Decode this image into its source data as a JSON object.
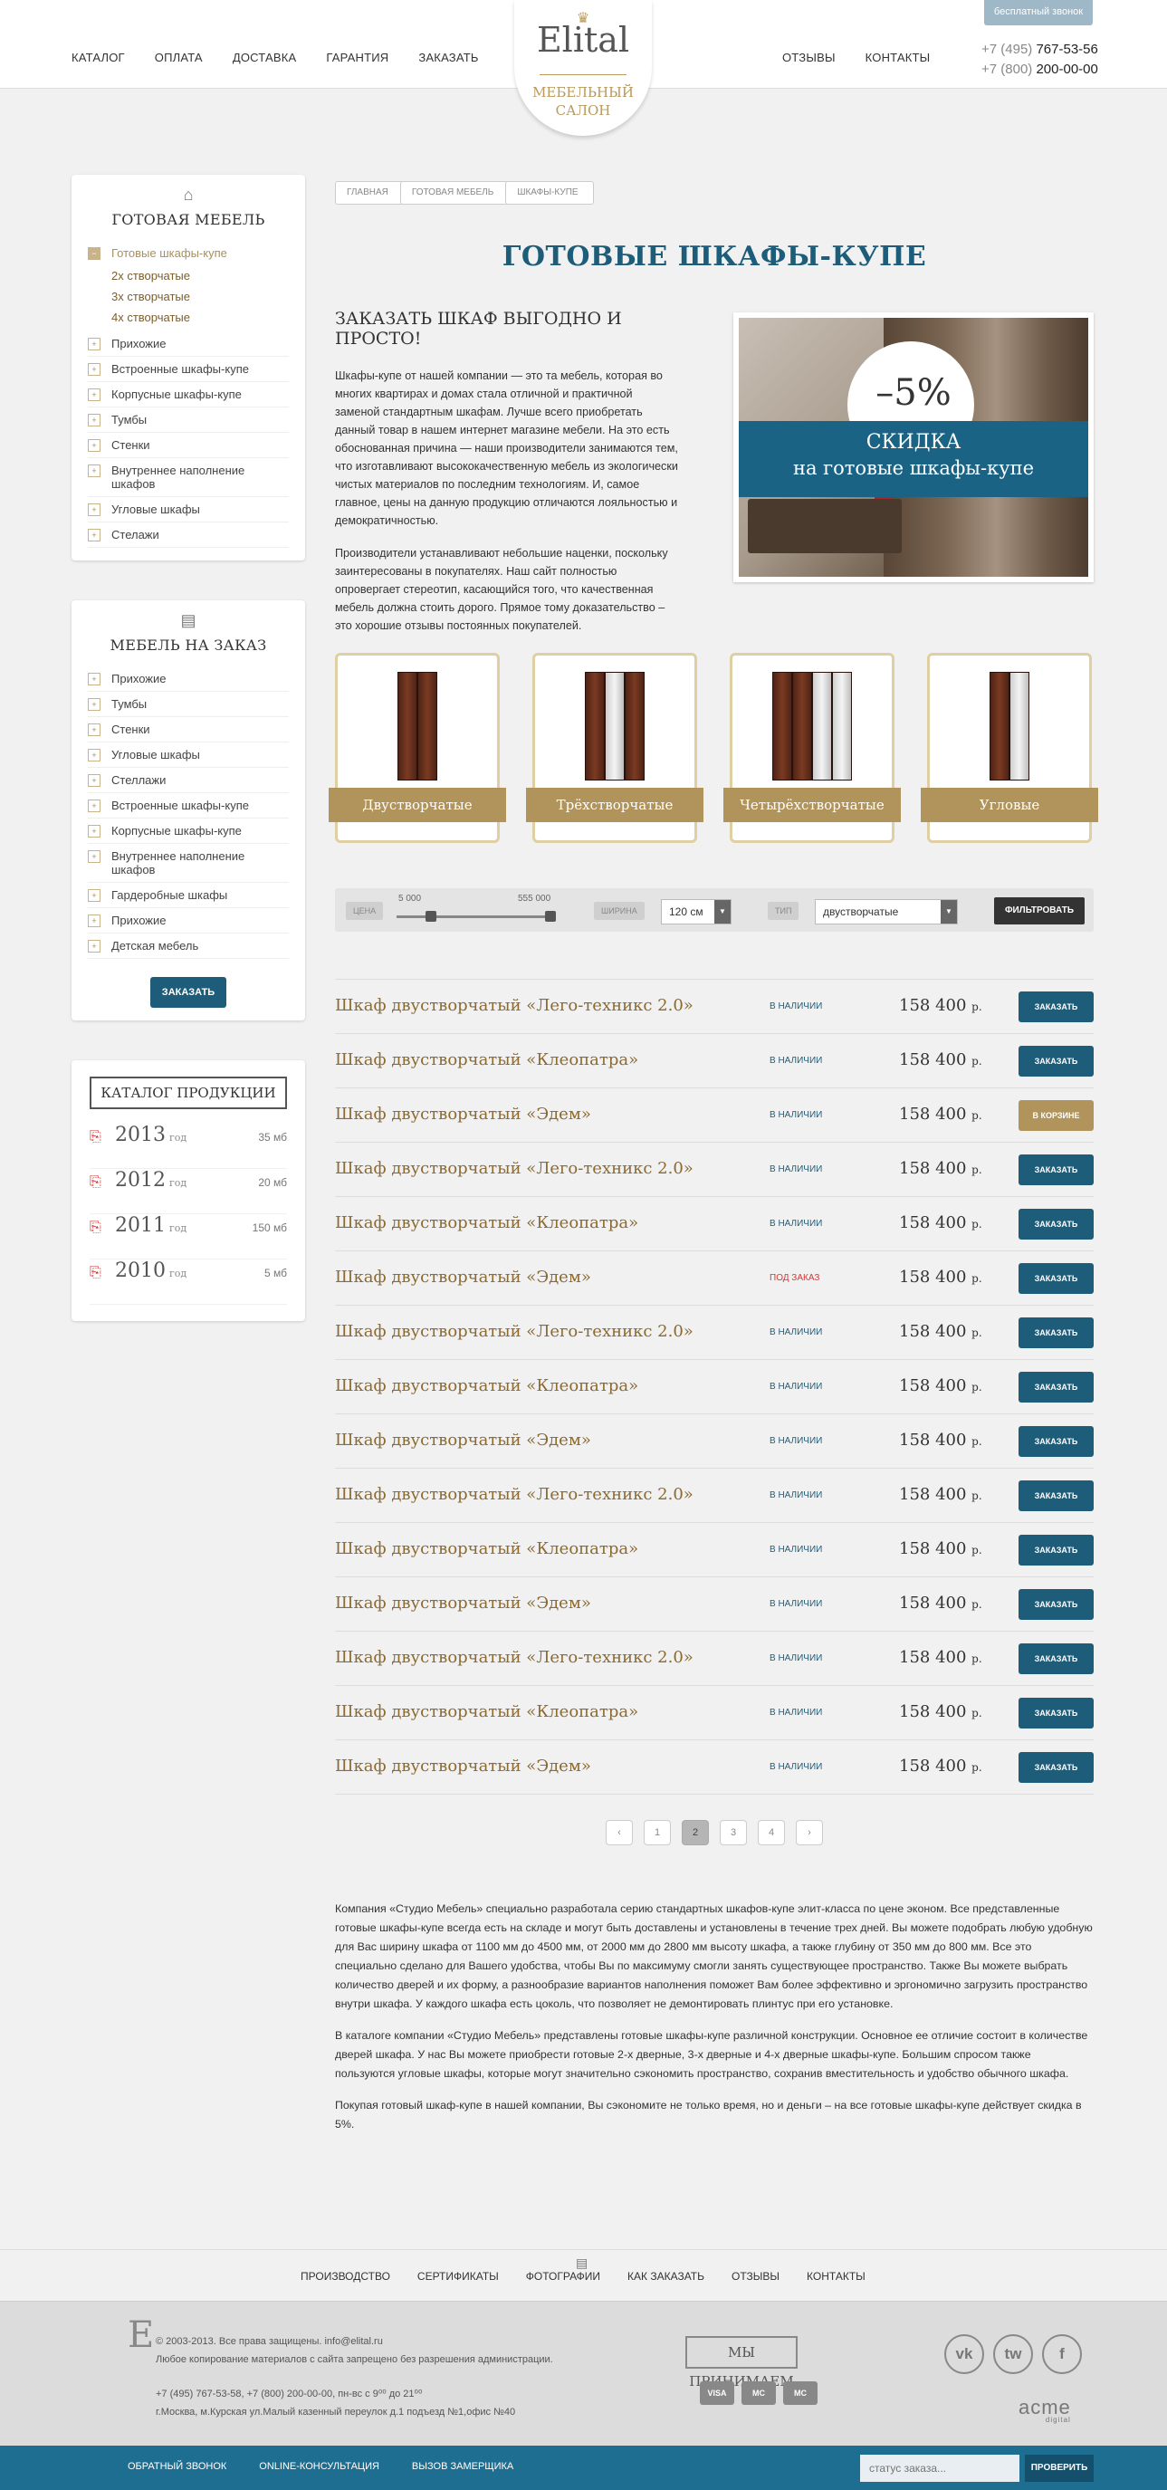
{
  "header": {
    "nav_left": [
      "Каталог",
      "Оплата",
      "Доставка",
      "Гарантия",
      "Заказать"
    ],
    "nav_right": [
      "Отзывы",
      "Контакты"
    ],
    "logo": {
      "name": "Elital",
      "sub1": "Мебельный",
      "sub2": "салон"
    },
    "callback_label": "бесплатный звонок",
    "phones": [
      {
        "code": "+7 (495)",
        "num": "767-53-56"
      },
      {
        "code": "+7 (800)",
        "num": "200-00-00"
      }
    ]
  },
  "sidebar": {
    "ready": {
      "title": "Готовая мебель",
      "active": "Готовые шкафы-купе",
      "subitems": [
        "2х створчатые",
        "3х створчатые",
        "4х створчатые"
      ],
      "items": [
        "Прихожие",
        "Встроенные шкафы-купе",
        "Корпусные шкафы-купе",
        "Тумбы",
        "Стенки",
        "Внутреннее наполнение шкафов",
        "Угловые шкафы",
        "Стелажи"
      ]
    },
    "custom": {
      "title": "Мебель на заказ",
      "items": [
        "Прихожие",
        "Тумбы",
        "Стенки",
        "Угловые шкафы",
        "Стеллажи",
        "Встроенные шкафы-купе",
        "Корпусные шкафы-купе",
        "Внутреннее наполнение шкафов",
        "Гардеробные шкафы",
        "Прихожие",
        "Детская мебель"
      ],
      "order_label": "Заказать"
    },
    "catalog": {
      "title": "Каталог продукции",
      "rows": [
        {
          "year": "2013",
          "unit": "год",
          "size": "35 мб"
        },
        {
          "year": "2012",
          "unit": "год",
          "size": "20 мб"
        },
        {
          "year": "2011",
          "unit": "год",
          "size": "150 мб"
        },
        {
          "year": "2010",
          "unit": "год",
          "size": "5 мб"
        }
      ]
    }
  },
  "main": {
    "breadcrumb": [
      "Главная",
      "Готовая мебель",
      "Шкафы-купе"
    ],
    "title": "Готовые шкафы-купе",
    "promo_heading": "Заказать шкаф выгодно и просто!",
    "promo_p1": "Шкафы-купе от нашей компании — это та мебель, которая во многих квартирах и домах стала отличной и практичной заменой стандартным шкафам. Лучше всего приобретать данный товар в нашем интернет магазине мебели. На это есть обоснованная причина — наши производители занимаются тем, что изготавливают высококачественную мебель из экологически чистых материалов по последним технологиям. И, самое главное, цены на данную продукцию отличаются лояльностью и демократичностью.",
    "promo_p2": "Производители устанавливают небольшие наценки, поскольку заинтересованы в покупателях. Наш сайт полностью опровергает стереотип, касающийся того, что качественная мебель должна стоить дорого. Прямое тому доказательство – это хорошие отзывы постоянных покупателей.",
    "banner": {
      "percent": "–5%",
      "line1": "Скидка",
      "line2": "на готовые шкафы-купе"
    },
    "categories": [
      {
        "label": "Двустворчатые",
        "panels": [
          "wood",
          "wood"
        ]
      },
      {
        "label": "Трёхстворчатые",
        "panels": [
          "wood",
          "mirror",
          "wood"
        ]
      },
      {
        "label": "Четырёхстворчатые",
        "panels": [
          "wood",
          "wood",
          "mirror",
          "mirror"
        ]
      },
      {
        "label": "Угловые",
        "panels": [
          "wood",
          "mirror"
        ]
      }
    ],
    "filter": {
      "price_tag": "Цена",
      "price_min": "5 000",
      "price_max": "555 000",
      "width_tag": "Ширина",
      "width_value": "120 см",
      "type_tag": "Тип",
      "type_value": "двустворчатые",
      "button": "Фильтровать"
    },
    "products": [
      {
        "name": "Шкаф двустворчатый «Лего-техникс 2.0»",
        "status": "в наличии",
        "price": "158 400",
        "btn": "Заказать"
      },
      {
        "name": "Шкаф двустворчатый «Клеопатра»",
        "status": "в наличии",
        "price": "158 400",
        "btn": "Заказать"
      },
      {
        "name": "Шкаф двустворчатый «Эдем»",
        "status": "в наличии",
        "price": "158 400",
        "btn": "В корзине"
      },
      {
        "name": "Шкаф двустворчатый «Лего-техникс 2.0»",
        "status": "в наличии",
        "price": "158 400",
        "btn": "Заказать"
      },
      {
        "name": "Шкаф двустворчатый «Клеопатра»",
        "status": "в наличии",
        "price": "158 400",
        "btn": "Заказать"
      },
      {
        "name": "Шкаф двустворчатый «Эдем»",
        "status": "под заказ",
        "price": "158 400",
        "btn": "Заказать"
      },
      {
        "name": "Шкаф двустворчатый «Лего-техникс 2.0»",
        "status": "в наличии",
        "price": "158 400",
        "btn": "Заказать"
      },
      {
        "name": "Шкаф двустворчатый «Клеопатра»",
        "status": "в наличии",
        "price": "158 400",
        "btn": "Заказать"
      },
      {
        "name": "Шкаф двустворчатый «Эдем»",
        "status": "в наличии",
        "price": "158 400",
        "btn": "Заказать"
      },
      {
        "name": "Шкаф двустворчатый «Лего-техникс 2.0»",
        "status": "в наличии",
        "price": "158 400",
        "btn": "Заказать"
      },
      {
        "name": "Шкаф двустворчатый «Клеопатра»",
        "status": "в наличии",
        "price": "158 400",
        "btn": "Заказать"
      },
      {
        "name": "Шкаф двустворчатый «Эдем»",
        "status": "в наличии",
        "price": "158 400",
        "btn": "Заказать"
      },
      {
        "name": "Шкаф двустворчатый «Лего-техникс 2.0»",
        "status": "в наличии",
        "price": "158 400",
        "btn": "Заказать"
      },
      {
        "name": "Шкаф двустворчатый «Клеопатра»",
        "status": "в наличии",
        "price": "158 400",
        "btn": "Заказать"
      },
      {
        "name": "Шкаф двустворчатый «Эдем»",
        "status": "в наличии",
        "price": "158 400",
        "btn": "Заказать"
      }
    ],
    "price_unit": "р.",
    "pager": [
      "‹",
      "1",
      "2",
      "3",
      "4",
      "›"
    ],
    "pager_current": "2",
    "seo": [
      "Компания «Студио Мебель» специально разработала серию стандартных шкафов-купе элит-класса по цене эконом. Все представленные готовые шкафы-купе всегда есть на складе и могут быть доставлены и установлены в течение трех дней. Вы можете подобрать любую удобную для Вас ширину шкафа от 1100 мм до 4500 мм, от 2000 мм до 2800 мм высоту шкафа, а также глубину от 350 мм до 800 мм. Все это специально сделано для Вашего удобства, чтобы Вы по максимуму смогли занять существующее пространство. Также Вы можете выбрать количество дверей и их форму, а разнообразие вариантов наполнения поможет Вам более эффективно и эргономично загрузить пространство внутри шкафа. У каждого шкафа есть цоколь, что позволяет не демонтировать плинтус при его установке.",
      "В каталоге компании «Студио Мебель» представлены готовые шкафы-купе различной конструкции. Основное ее отличие состоит в количестве дверей шкафа. У нас Вы можете приобрести готовые 2-х дверные, 3-х дверные и 4-х дверные шкафы-купе. Большим спросом также пользуются угловые шкафы, которые могут значительно сэкономить пространство, сохранив вместительность и удобство обычного шкафа.",
      "Покупая готовый шкаф-купе в нашей компании, Вы сэкономите не только время, но и деньги – на все готовые шкафы-купе действует скидка в 5%."
    ]
  },
  "footer": {
    "nav": [
      "Производство",
      "Сертификаты",
      "Фотографии",
      "Как заказать",
      "Отзывы",
      "Контакты"
    ],
    "logo_letter": "E",
    "copyright": "© 2003-2013. Все права защищены. info@elital.ru",
    "copy_note": "Любое копирование материалов с сайта запрещено без разрешения администрации.",
    "contacts": "+7 (495) 767-53-58, +7 (800) 200-00-00, пн-вс с 9⁰⁰ до 21⁰⁰",
    "address": "г.Москва, м.Курская ул.Малый казенный переулок д.1 подъезд №1,офис №40",
    "accept_label": "Мы принимаем",
    "cards": [
      "VISA",
      "MC",
      "MC"
    ],
    "socials": [
      "vk",
      "tw",
      "f"
    ],
    "acme": "acme",
    "acme_sub": "digital",
    "bottom_links": [
      "Обратный звонок",
      "Online-консультация",
      "Вызов замерщика"
    ],
    "status_placeholder": "статус заказа...",
    "status_btn": "Проверить"
  }
}
